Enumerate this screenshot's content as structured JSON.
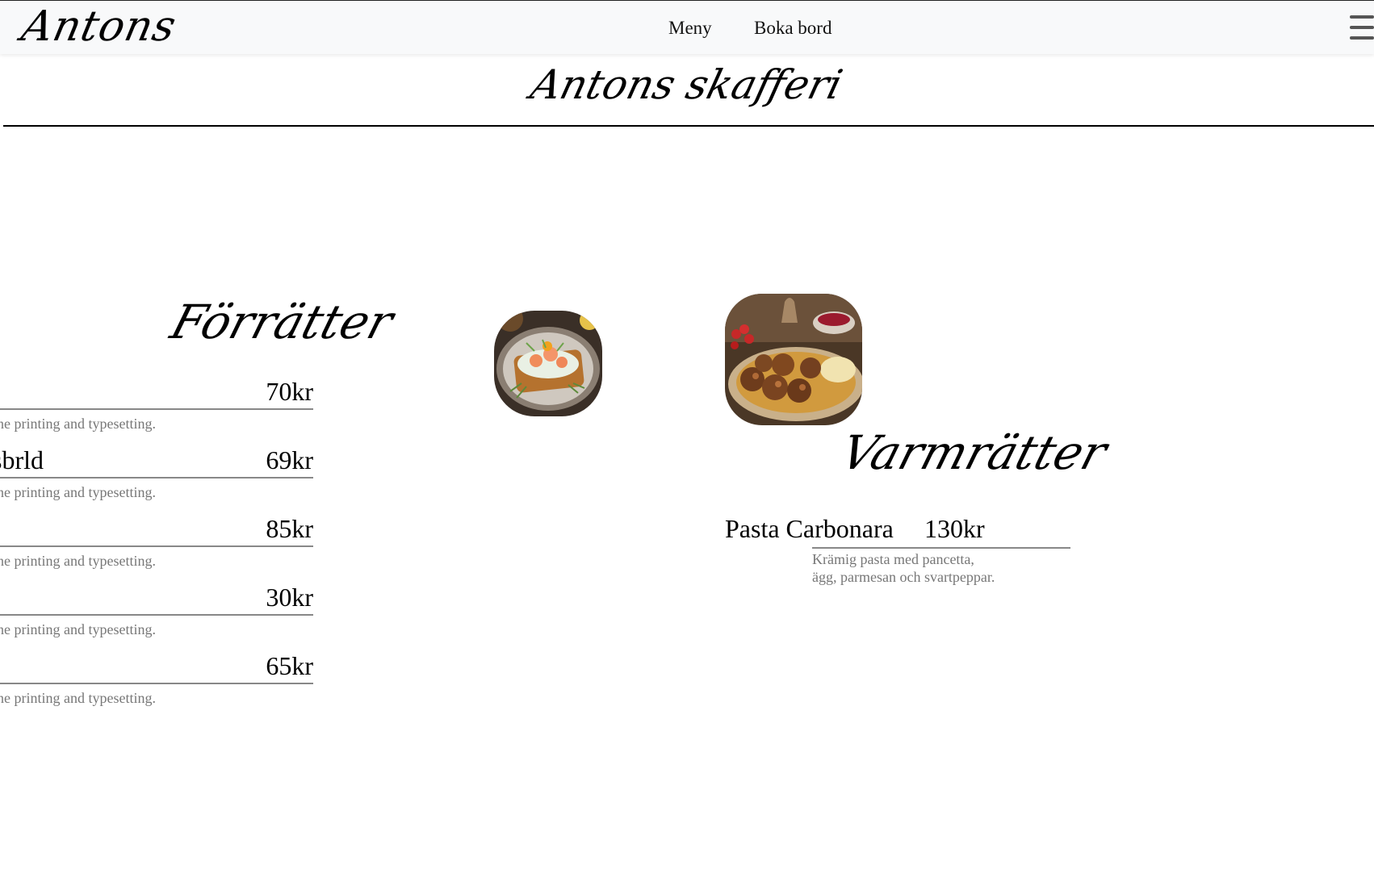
{
  "navbar": {
    "brand": "Antons",
    "links": [
      "Meny",
      "Boka bord"
    ],
    "menu_icon": "hamburger-menu-icon"
  },
  "header": {
    "title": "Antons skafferi"
  },
  "starters": {
    "heading": "Förrätter",
    "items": [
      {
        "name": "",
        "price": "70kr",
        "description": "he printing and typesetting."
      },
      {
        "name": "sbrld",
        "price": "69kr",
        "description": "he printing and typesetting."
      },
      {
        "name": "",
        "price": "85kr",
        "description": "he printing and typesetting."
      },
      {
        "name": "",
        "price": "30kr",
        "description": "he printing and typesetting."
      },
      {
        "name": "",
        "price": "65kr",
        "description": "he printing and typesetting."
      }
    ],
    "image": "shrimp-toast-image"
  },
  "mains": {
    "heading": "Varmrätter",
    "image": "meatballs-dish-image",
    "items": [
      {
        "name": "Pasta Carbonara",
        "price": "130kr",
        "description_line1": "Krämig pasta med pancetta,",
        "description_line2": "ägg, parmesan och svartpeppar."
      }
    ]
  }
}
